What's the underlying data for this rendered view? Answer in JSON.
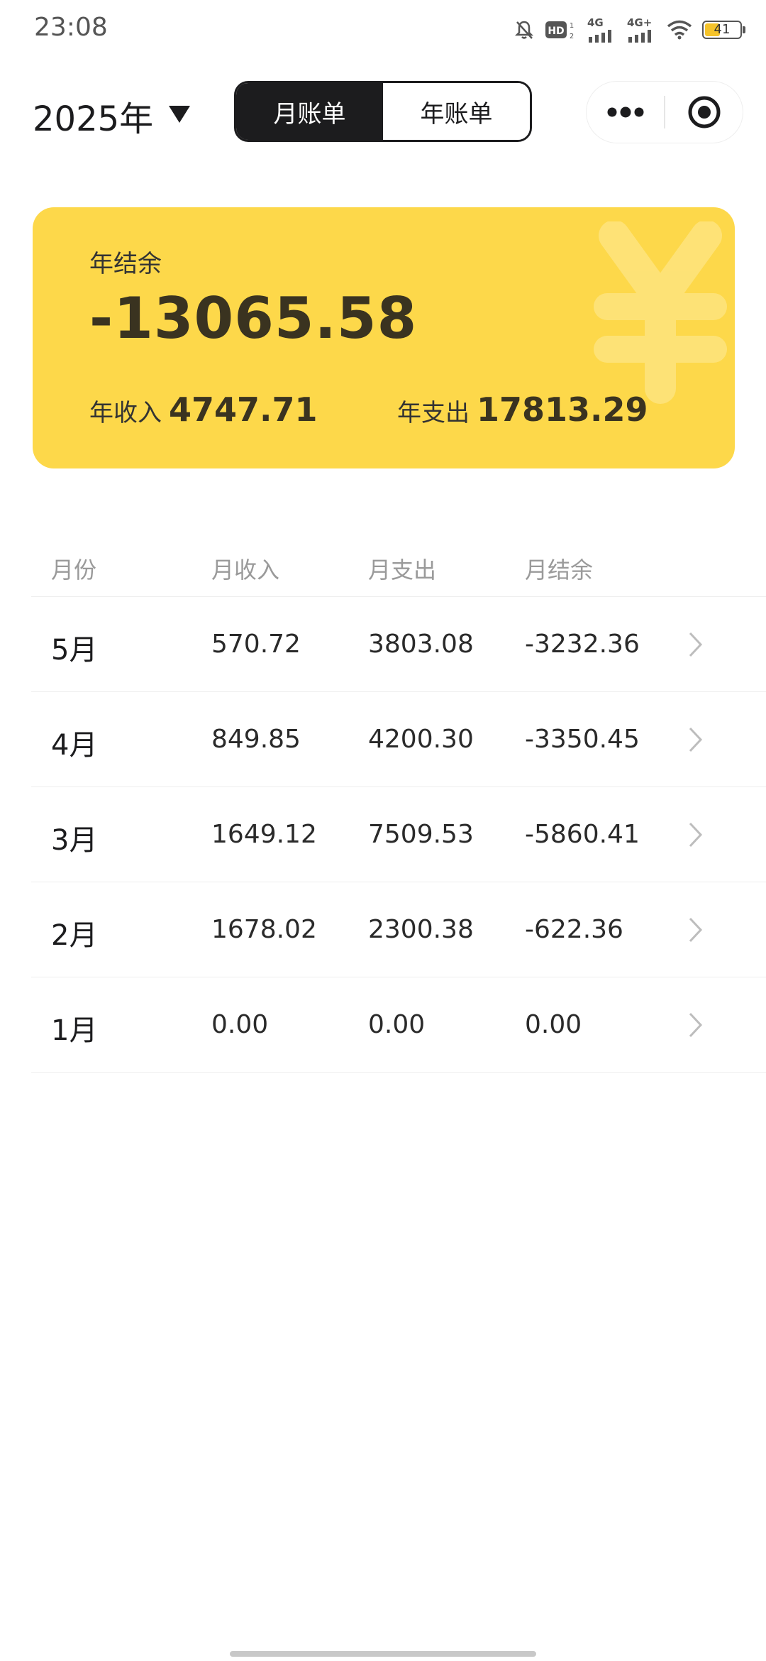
{
  "status_bar": {
    "time": "23:08",
    "network_1": "4G",
    "network_2": "4G+",
    "battery": "41",
    "icons": [
      "mute-bell-icon",
      "hd-icon",
      "signal-icon",
      "signal-icon",
      "wifi-icon",
      "battery-icon"
    ]
  },
  "header": {
    "year": "2025年",
    "tabs": [
      {
        "label": "月账单",
        "active": true
      },
      {
        "label": "年账单",
        "active": false
      }
    ],
    "capsule_icons": [
      "more-dots-icon",
      "close-target-icon"
    ]
  },
  "summary": {
    "title": "年结余",
    "balance": "-13065.58",
    "income_label": "年收入",
    "income_value": "4747.71",
    "expense_label": "年支出",
    "expense_value": "17813.29",
    "card_color": "#fdd84a",
    "watermark_icon": "yen-icon"
  },
  "table": {
    "headers": [
      "月份",
      "月收入",
      "月支出",
      "月结余"
    ],
    "rows": [
      {
        "month": "5月",
        "income": "570.72",
        "expense": "3803.08",
        "balance": "-3232.36"
      },
      {
        "month": "4月",
        "income": "849.85",
        "expense": "4200.30",
        "balance": "-3350.45"
      },
      {
        "month": "3月",
        "income": "1649.12",
        "expense": "7509.53",
        "balance": "-5860.41"
      },
      {
        "month": "2月",
        "income": "1678.02",
        "expense": "2300.38",
        "balance": "-622.36"
      },
      {
        "month": "1月",
        "income": "0.00",
        "expense": "0.00",
        "balance": "0.00"
      }
    ]
  }
}
